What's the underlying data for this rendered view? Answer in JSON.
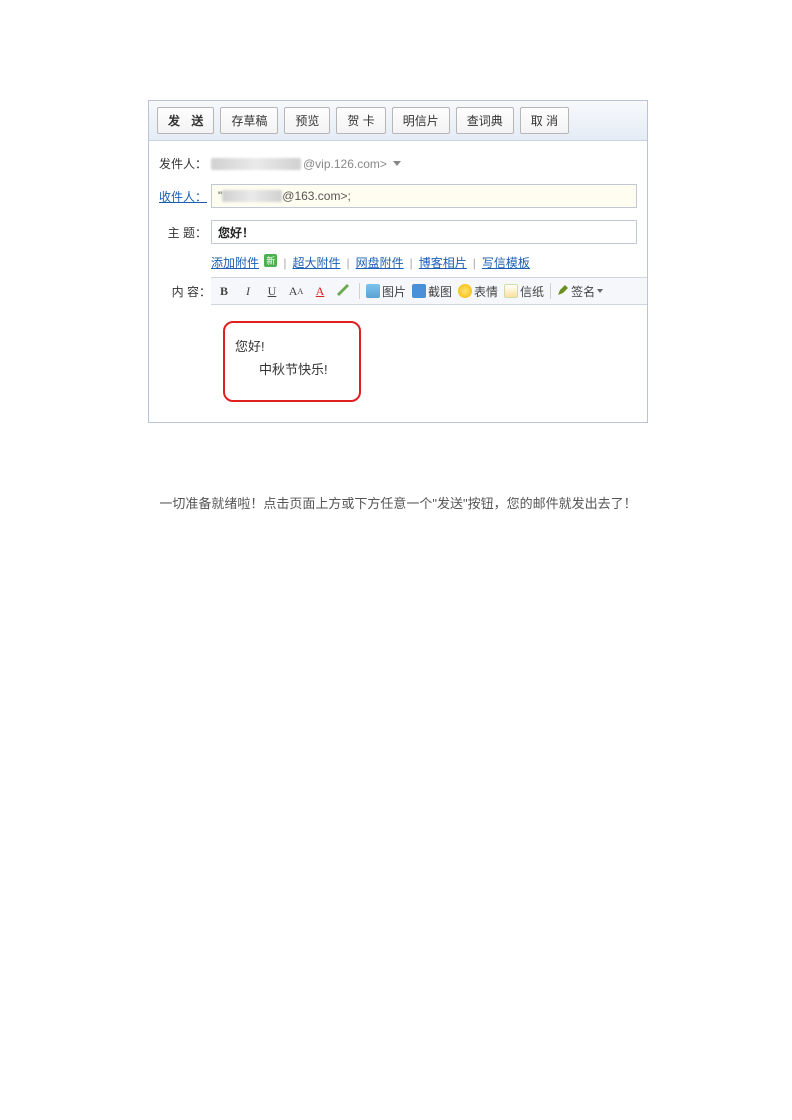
{
  "toolbar": {
    "send": "发 送",
    "draft": "存草稿",
    "preview": "预览",
    "card": "贺 卡",
    "postcard": "明信片",
    "dict": "查词典",
    "cancel": "取 消"
  },
  "labels": {
    "from": "发件人：",
    "to": "收件人：",
    "subject": "主 题：",
    "content": "内 容："
  },
  "from": {
    "domain": "@vip.126.com>"
  },
  "to": {
    "prefix": "\"",
    "domain": "@163.com>;"
  },
  "subject": "您好！",
  "attachments": {
    "add": "添加附件",
    "badge": "新",
    "big": "超大附件",
    "disk": "网盘附件",
    "blog": "博客相片",
    "template": "写信模板"
  },
  "editor": {
    "image": "图片",
    "screenshot": "截图",
    "emoji": "表情",
    "paper": "信纸",
    "sign": "签名"
  },
  "body": {
    "line1": "您好!",
    "line2": "中秋节快乐!"
  },
  "caption": "一切准备就绪啦！点击页面上方或下方任意一个\"发送\"按钮，您的邮件就发出去了！"
}
